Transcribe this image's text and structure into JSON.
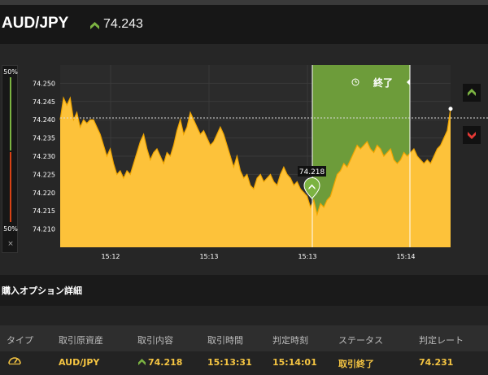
{
  "header": {
    "pair": "AUD/JPY",
    "price": "74.243",
    "trend_icon": "up-chevron-icon",
    "up_color": "#7cb342"
  },
  "gauge": {
    "top_pct": "50%",
    "bottom_pct": "50%",
    "close_glyph": "×",
    "call_share": 0.5,
    "put_share": 0.5
  },
  "chart_data": {
    "type": "area",
    "y_ticks": [
      "74.250",
      "74.245",
      "74.240",
      "74.235",
      "74.230",
      "74.225",
      "74.220",
      "74.215",
      "74.210"
    ],
    "x_ticks": [
      "15:12",
      "15:13",
      "15:13",
      "15:14"
    ],
    "ylim": [
      74.205,
      74.255
    ],
    "series": [
      {
        "values": [
          74.24,
          74.246,
          74.244,
          74.246,
          74.24,
          74.242,
          74.238,
          74.24,
          74.239,
          74.24,
          74.24,
          74.238,
          74.236,
          74.233,
          74.23,
          74.232,
          74.228,
          74.225,
          74.226,
          74.224,
          74.226,
          74.225,
          74.228,
          74.231,
          74.234,
          74.236,
          74.232,
          74.229,
          74.231,
          74.232,
          74.23,
          74.228,
          74.231,
          74.23,
          74.233,
          74.237,
          74.24,
          74.236,
          74.238,
          74.242,
          74.24,
          74.238,
          74.236,
          74.237,
          74.235,
          74.233,
          74.234,
          74.236,
          74.238,
          74.236,
          74.233,
          74.23,
          74.227,
          74.23,
          74.226,
          74.224,
          74.225,
          74.222,
          74.221,
          74.224,
          74.225,
          74.223,
          74.224,
          74.225,
          74.223,
          74.222,
          74.225,
          74.227,
          74.225,
          74.224,
          74.222,
          74.223,
          74.221,
          74.22,
          74.219,
          74.216,
          74.218,
          74.214,
          74.217,
          74.216,
          74.218,
          74.219,
          74.222,
          74.225,
          74.226,
          74.228,
          74.227,
          74.229,
          74.231,
          74.233,
          74.232,
          74.233,
          74.234,
          74.232,
          74.231,
          74.233,
          74.232,
          74.23,
          74.231,
          74.232,
          74.229,
          74.228,
          74.229,
          74.231,
          74.23,
          74.231,
          74.232,
          74.23,
          74.229,
          74.228,
          74.229,
          74.228,
          74.23,
          74.232,
          74.233,
          74.235,
          74.237,
          74.243
        ]
      }
    ],
    "entry_price_label": "74.218",
    "reference_level": 74.2405,
    "expiry_label": "終了",
    "in_the_money_color": "#6d9c3a",
    "area_color": "#fdc23a"
  },
  "side_buttons": {
    "call_icon": "up-chevron-icon",
    "put_icon": "down-chevron-icon",
    "put_color": "#e53935"
  },
  "details": {
    "title": "購入オプション詳細",
    "columns": [
      "タイプ",
      "取引原資産",
      "取引内容",
      "取引時間",
      "判定時刻",
      "ステータス",
      "判定レート"
    ],
    "row": {
      "type_icon": "gauge-icon",
      "asset": "AUD/JPY",
      "content": "74.218",
      "trade_time": "15:13:31",
      "judge_time": "15:14:01",
      "status": "取引終了",
      "rate": "74.231"
    }
  }
}
